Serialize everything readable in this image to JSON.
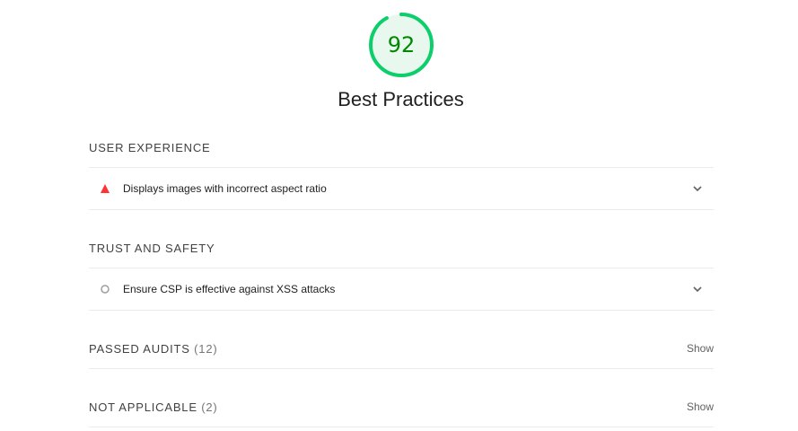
{
  "category": {
    "score": "92",
    "score_fraction": 0.92,
    "title": "Best Practices",
    "colors": {
      "pass": "#0cce6b",
      "pass_text": "#008800",
      "fail": "#ff3333",
      "neutral": "#9e9e9e"
    }
  },
  "groups": [
    {
      "title": "User Experience",
      "audits": [
        {
          "label": "Displays images with incorrect aspect ratio",
          "status_icon": "warning-triangle-icon",
          "expand_icon": "chevron-down-icon"
        }
      ]
    },
    {
      "title": "Trust and Safety",
      "audits": [
        {
          "label": "Ensure CSP is effective against XSS attacks",
          "status_icon": "informative-circle-icon",
          "expand_icon": "chevron-down-icon"
        }
      ]
    }
  ],
  "passed": {
    "title": "Passed audits",
    "count": "(12)",
    "toggle_label": "Show"
  },
  "not_applicable": {
    "title": "Not applicable",
    "count": "(2)",
    "toggle_label": "Show"
  }
}
